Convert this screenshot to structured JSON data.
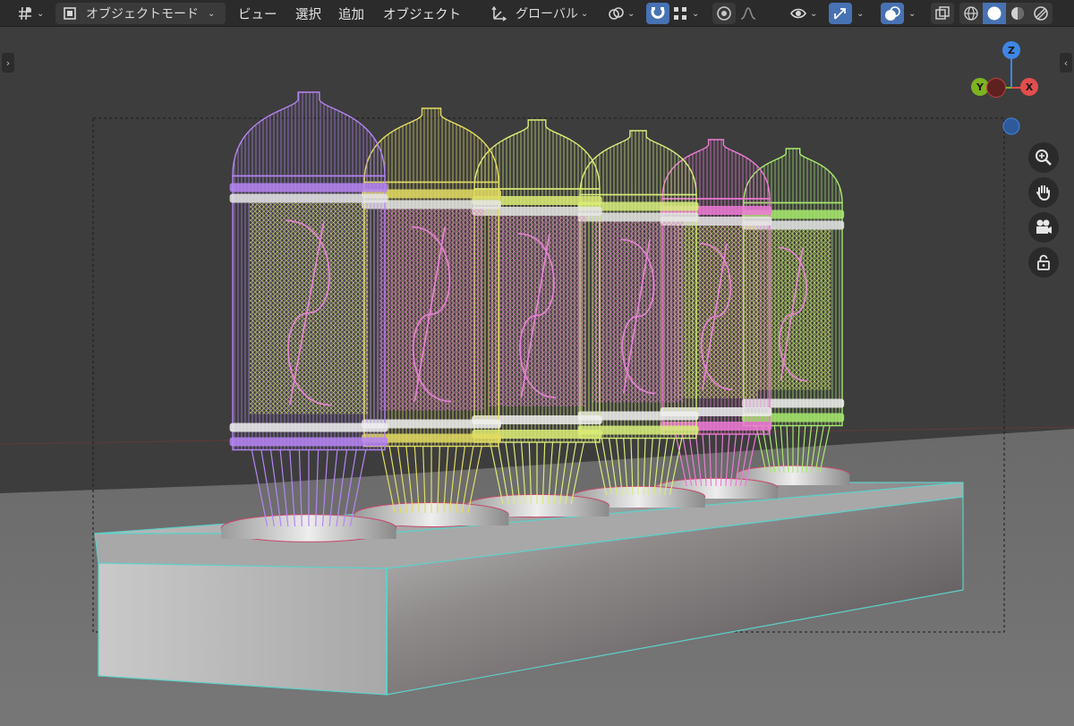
{
  "header": {
    "mode_label": "オブジェクトモード",
    "menu": [
      "ビュー",
      "選択",
      "追加",
      "オブジェクト"
    ],
    "transform_orientation": "グローバル"
  },
  "gizmo": {
    "z": "Z",
    "y": "Y",
    "x": "X"
  },
  "icons": {
    "editor_type": "viewport-editor-icon",
    "mode": "object-mode-icon",
    "orientation": "transform-orientation-icon",
    "pivot": "pivot-point-icon",
    "snap": "snap-magnet-icon",
    "snap_target": "snap-increment-icon",
    "proportional": "proportional-edit-icon",
    "falloff": "falloff-curve-icon",
    "visibility": "object-visibility-icon",
    "gizmo": "gizmo-icon",
    "overlays": "overlays-icon",
    "xray": "xray-icon",
    "shading": [
      "wireframe-shading-icon",
      "solid-shading-icon",
      "material-shading-icon",
      "rendered-shading-icon"
    ],
    "navigate": [
      "zoom-icon",
      "pan-hand-icon",
      "camera-view-icon",
      "lock-icon"
    ]
  },
  "colors": {
    "viewport_bg": "#3d3d3d",
    "header_bg": "#2b2b2b",
    "accent_blue": "#4772b3",
    "axis_x": "#e34d4d",
    "axis_y": "#7db41e",
    "axis_z": "#3f86e3",
    "tube_colors": [
      "#b685f5",
      "#e3dc62",
      "#dcec76",
      "#d7ee7c",
      "#ee7ad6",
      "#a7ea6d"
    ]
  }
}
